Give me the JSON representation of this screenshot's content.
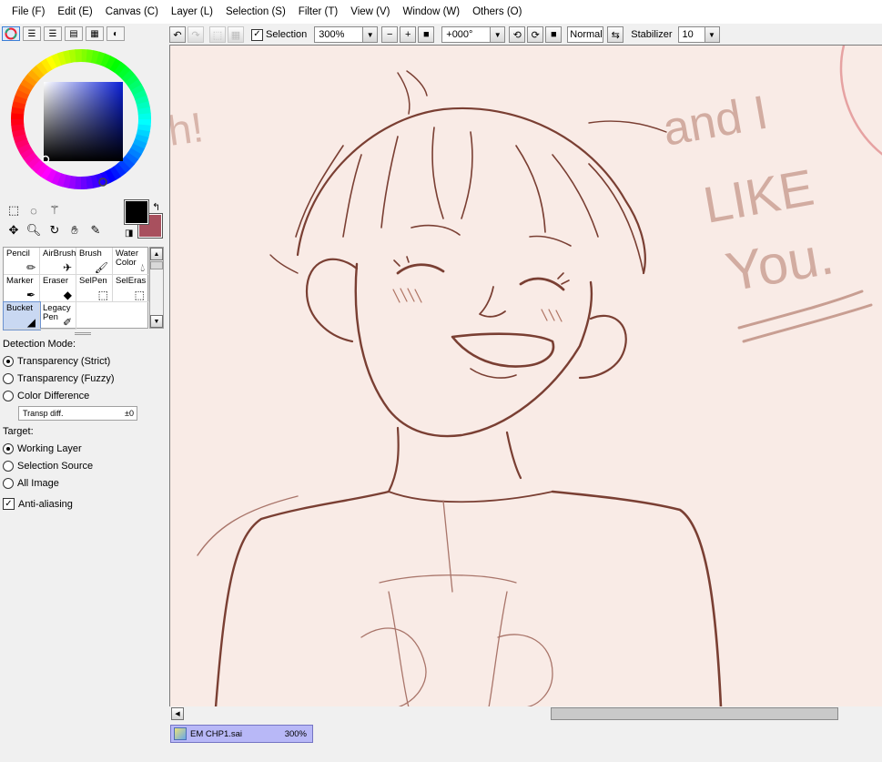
{
  "menu": [
    {
      "label": "File (F)"
    },
    {
      "label": "Edit (E)"
    },
    {
      "label": "Canvas (C)"
    },
    {
      "label": "Layer (L)"
    },
    {
      "label": "Selection (S)"
    },
    {
      "label": "Filter (T)"
    },
    {
      "label": "View (V)"
    },
    {
      "label": "Window (W)"
    },
    {
      "label": "Others (O)"
    }
  ],
  "toolbar": {
    "selection_label": "Selection",
    "selection_checked": true,
    "zoom": "300%",
    "rotation": "+000°",
    "blend_mode": "Normal",
    "stabilizer_label": "Stabilizer",
    "stabilizer_value": "10"
  },
  "colors": {
    "foreground": "#000000",
    "background": "#a8505e"
  },
  "brushes": [
    {
      "label": "Pencil",
      "icon": "pencil-icon"
    },
    {
      "label": "AirBrush",
      "icon": "airbrush-icon"
    },
    {
      "label": "Brush",
      "icon": "brush-icon"
    },
    {
      "label": "Water Color",
      "icon": "watercolor-icon"
    },
    {
      "label": "Marker",
      "icon": "marker-icon"
    },
    {
      "label": "Eraser",
      "icon": "eraser-icon"
    },
    {
      "label": "SelPen",
      "icon": "selpen-icon"
    },
    {
      "label": "SelEras",
      "icon": "seleras-icon"
    },
    {
      "label": "Bucket",
      "icon": "bucket-icon",
      "selected": true
    },
    {
      "label": "Legacy Pen",
      "icon": "legacy-pen-icon"
    }
  ],
  "detection": {
    "heading": "Detection Mode:",
    "options": [
      "Transparency (Strict)",
      "Transparency (Fuzzy)",
      "Color Difference"
    ],
    "selected": 0,
    "diff_label": "Transp diff.",
    "diff_value": "±0"
  },
  "target": {
    "heading": "Target:",
    "options": [
      "Working Layer",
      "Selection Source",
      "All Image"
    ],
    "selected": 0
  },
  "antialias": {
    "label": "Anti-aliasing",
    "checked": true
  },
  "canvas": {
    "lettering": [
      "and I",
      "LIKE",
      "You."
    ],
    "side_text": "h!"
  },
  "document": {
    "name": "EM CHP1.sai",
    "zoom": "300%"
  }
}
